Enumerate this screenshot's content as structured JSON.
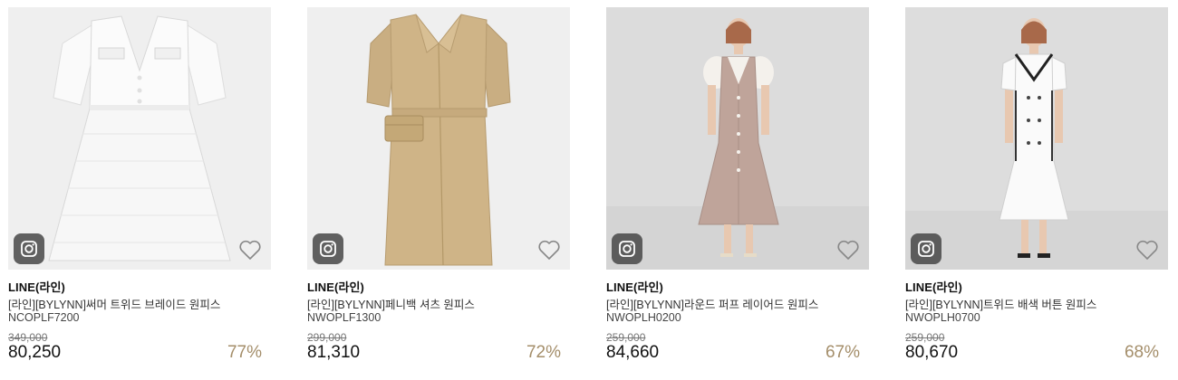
{
  "products": [
    {
      "brand": "LINE(라인)",
      "name": "[라인][BYLYNN]써머 트위드 브레이드 원피스",
      "code": "NCOPLF7200",
      "original_price": "349,000",
      "price": "80,250",
      "discount": "77%",
      "image": "white-tweed-dress-flatlay"
    },
    {
      "brand": "LINE(라인)",
      "name": "[라인][BYLYNN]페니백 셔츠 원피스",
      "code": "NWOPLF1300",
      "original_price": "299,000",
      "price": "81,310",
      "discount": "72%",
      "image": "beige-shirt-dress-flatlay"
    },
    {
      "brand": "LINE(라인)",
      "name": "[라인][BYLYNN]라운드 퍼프 레이어드 원피스",
      "code": "NWOPLH0200",
      "original_price": "259,000",
      "price": "84,660",
      "discount": "67%",
      "image": "pink-layered-dress-model"
    },
    {
      "brand": "LINE(라인)",
      "name": "[라인][BYLYNN]트위드 배색 버튼 원피스",
      "code": "NWOPLH0700",
      "original_price": "259,000",
      "price": "80,670",
      "discount": "68%",
      "image": "white-tweed-button-dress-model"
    }
  ],
  "icons": {
    "instagram": "instagram-icon",
    "wishlist": "heart-outline-icon"
  },
  "colors": {
    "discount": "#a48e6a",
    "photo_bg_flat": "#efefef",
    "photo_bg_model": "#dcdcdc"
  }
}
